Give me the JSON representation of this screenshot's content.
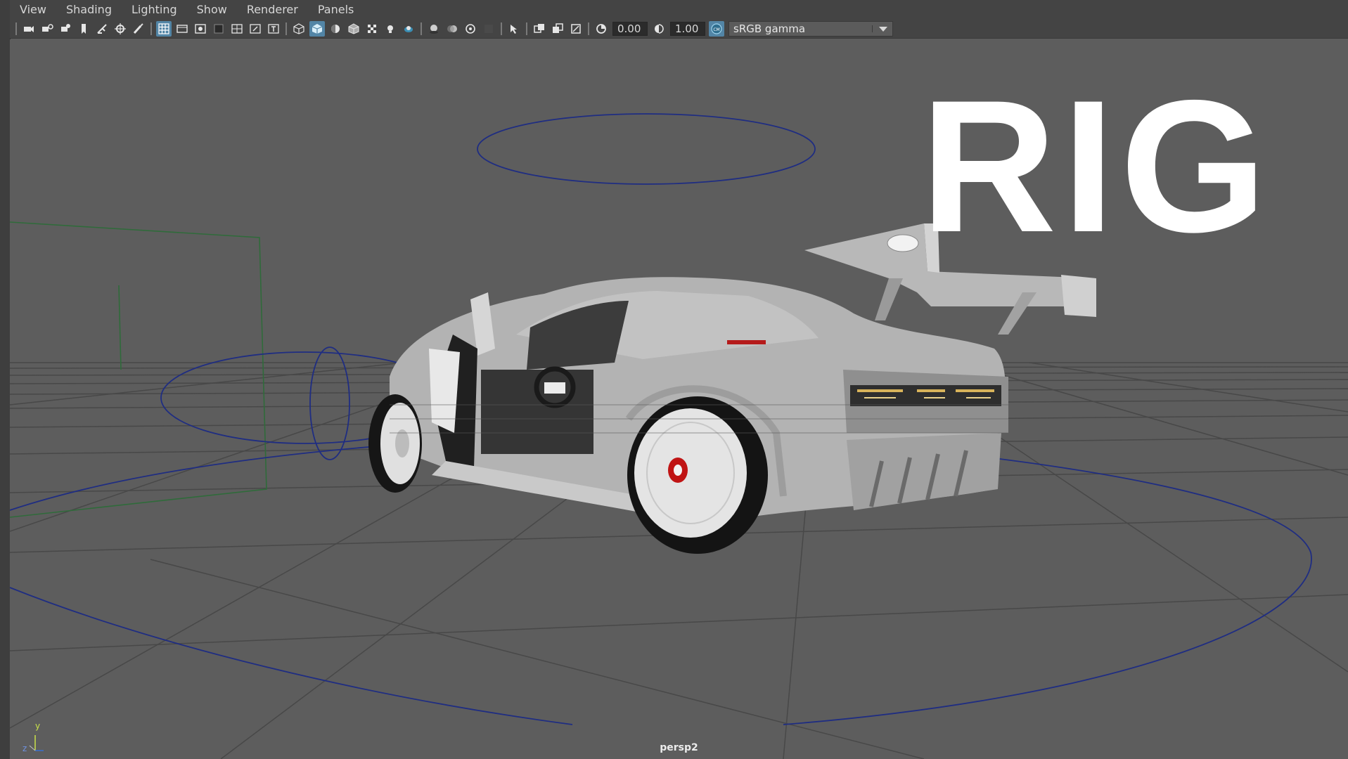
{
  "menu": {
    "items": [
      "View",
      "Shading",
      "Lighting",
      "Show",
      "Renderer",
      "Panels"
    ]
  },
  "toolbar": {
    "exposure_value": "0.00",
    "gamma_value": "1.00",
    "color_space": "sRGB gamma",
    "icons": [
      "camera-select-icon",
      "camera-attributes-icon",
      "bookmark-icon",
      "image-plane-icon",
      "transform-icon",
      "paint-icon",
      "grid-icon",
      "film-gate-icon",
      "resolution-gate-icon",
      "gate-mask-icon",
      "field-chart-icon",
      "safe-action-icon",
      "safe-title-icon",
      "wireframe-icon",
      "smooth-shade-icon",
      "default-material-icon",
      "wireframe-on-shaded-icon",
      "textured-icon",
      "use-lights-icon",
      "shadows-icon",
      "screen-space-ao-icon",
      "motion-blur-icon",
      "anti-aliasing-icon",
      "depth-of-field-icon",
      "isolate-select-icon",
      "xray-icon",
      "xray-joints-icon",
      "backface-culling-icon",
      "exposure-icon",
      "gamma-icon",
      "color-management-icon"
    ]
  },
  "viewport": {
    "overlay_title": "RIG",
    "camera_name": "persp2",
    "axis_labels": {
      "y": "y",
      "z": "z"
    }
  }
}
